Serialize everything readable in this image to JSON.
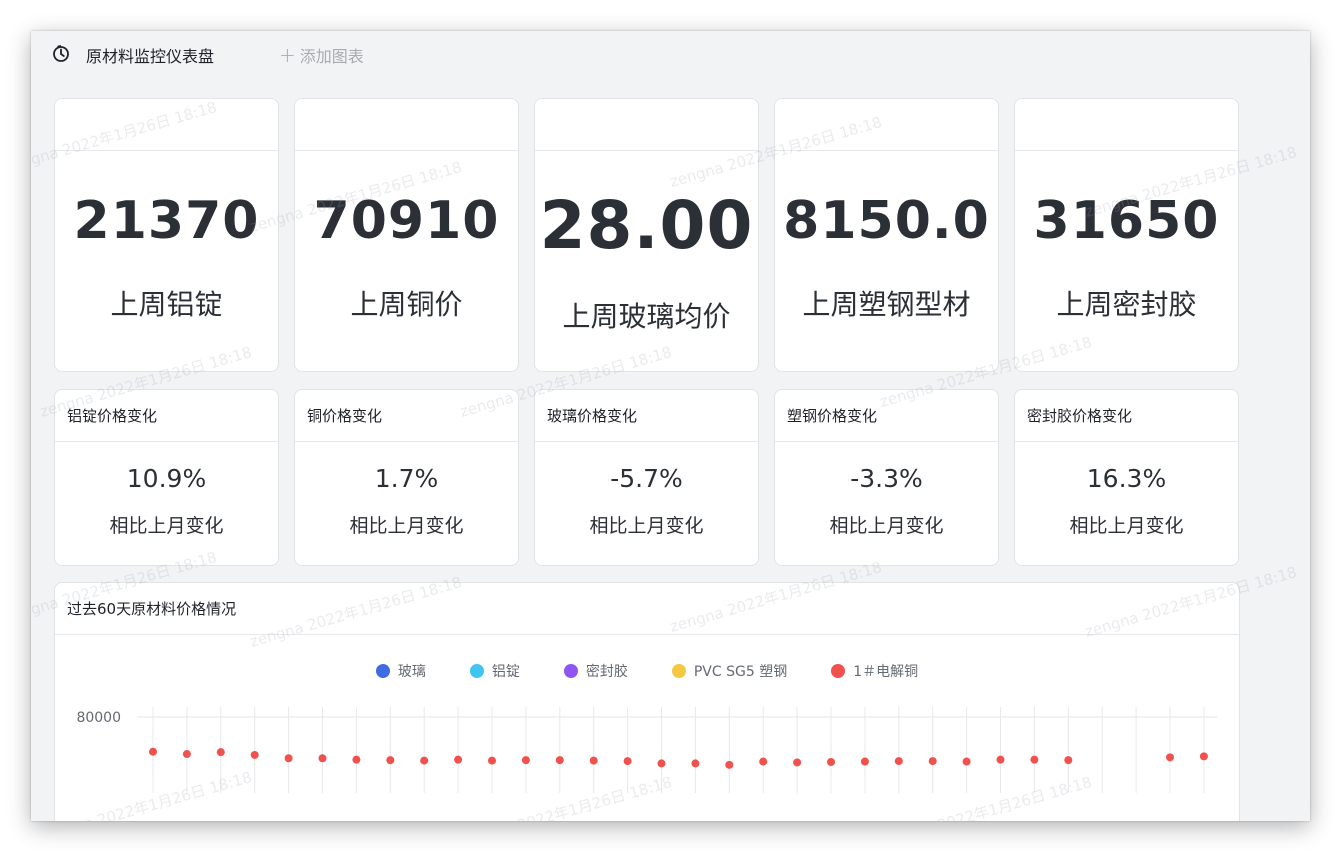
{
  "header": {
    "title": "原材料监控仪表盘",
    "add_label": "添加图表"
  },
  "kpis": [
    {
      "value": "21370",
      "label": "上周铝锭"
    },
    {
      "value": "70910",
      "label": "上周铜价"
    },
    {
      "value": "28.00",
      "label": "上周玻璃均价"
    },
    {
      "value": "8150.0",
      "label": "上周塑钢型材"
    },
    {
      "value": "31650",
      "label": "上周密封胶"
    }
  ],
  "changes": [
    {
      "title": "铝锭价格变化",
      "value": "10.9%",
      "label": "相比上月变化"
    },
    {
      "title": "铜价格变化",
      "value": "1.7%",
      "label": "相比上月变化"
    },
    {
      "title": "玻璃价格变化",
      "value": "-5.7%",
      "label": "相比上月变化"
    },
    {
      "title": "塑钢价格变化",
      "value": "-3.3%",
      "label": "相比上月变化"
    },
    {
      "title": "密封胶价格变化",
      "value": "16.3%",
      "label": "相比上月变化"
    }
  ],
  "watermark_text": "zengna 2022年1月26日 18:18",
  "chart_data": {
    "type": "scatter",
    "title": "过去60天原材料价格情况",
    "y_tick_labels": [
      "80000"
    ],
    "legend_placement": "top-center",
    "grid": true,
    "series": [
      {
        "name": "玻璃",
        "color": "#3f6ce0",
        "values": []
      },
      {
        "name": "铝锭",
        "color": "#40c4f0",
        "values": []
      },
      {
        "name": "密封胶",
        "color": "#8f55f2",
        "values": []
      },
      {
        "name": "PVC SG5 塑钢",
        "color": "#f5c842",
        "values": []
      },
      {
        "name": "1＃电解铜",
        "color": "#f0514d",
        "values": [
          72600,
          72100,
          72500,
          71900,
          71200,
          71200,
          70900,
          70800,
          70700,
          70900,
          70700,
          70800,
          70800,
          70700,
          70600,
          70100,
          70100,
          69800,
          70500,
          70300,
          70400,
          70500,
          70600,
          70600,
          70500,
          70900,
          70900,
          70800,
          null,
          null,
          71400,
          71600
        ]
      }
    ],
    "ylim": [
      62000,
      80000
    ]
  }
}
